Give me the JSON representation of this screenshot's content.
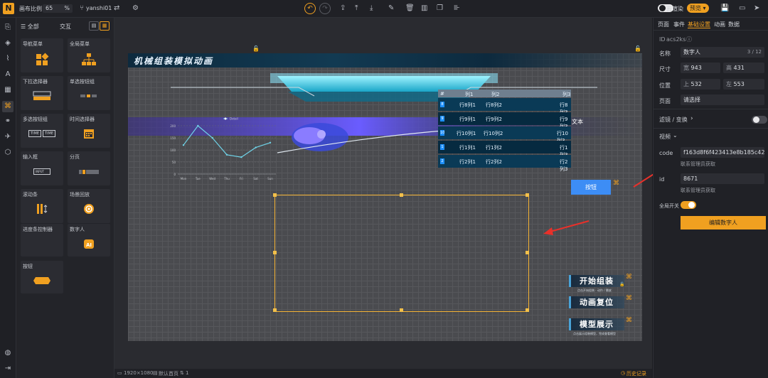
{
  "toolbar": {
    "logo_glyph": "N",
    "scale_label": "画布比例",
    "scale_value": "65",
    "scale_unit": "%",
    "user_name": "yanshi01",
    "cloud_render_label": "云渲染",
    "preview_label": "预览"
  },
  "left_panel": {
    "tab_all": "全部",
    "tab_interact": "交互",
    "components": [
      {
        "label": "导航菜单"
      },
      {
        "label": "全局菜单"
      },
      {
        "label": "下拉选择器"
      },
      {
        "label": "单选按钮组"
      },
      {
        "label": "多选按钮组"
      },
      {
        "label": "时间选择器"
      },
      {
        "label": "输入框"
      },
      {
        "label": "分页"
      },
      {
        "label": "滚动条"
      },
      {
        "label": "场景回放"
      },
      {
        "label": "进度条控制器"
      },
      {
        "label": "数字人"
      },
      {
        "label": "按钮"
      }
    ],
    "input_placeholder": "INPUT",
    "time_a": "TIME",
    "time_b": "TIME"
  },
  "stage": {
    "title": "机械组装模拟动画",
    "table": {
      "headers": [
        "#",
        "列1",
        "列2",
        "列3"
      ],
      "rows": [
        {
          "n": "8",
          "c1": "行8列1",
          "c2": "行8列2",
          "c3": "行8列3"
        },
        {
          "n": "9",
          "c1": "行9列1",
          "c2": "行9列2",
          "c3": "行9列3"
        },
        {
          "n": "10",
          "c1": "行10列1",
          "c2": "行10列2",
          "c3": "行10列3"
        },
        {
          "n": "1",
          "c1": "行1列1",
          "c2": "行1列2",
          "c3": "行1列3"
        },
        {
          "n": "2",
          "c1": "行2列1",
          "c2": "行2列2",
          "c3": "行2列3"
        }
      ]
    },
    "text_label": "文本",
    "button_label": "按钮",
    "action_buttons": [
      {
        "label": "开始组装",
        "sub": "点击开始组装 · 动作 / 播放"
      },
      {
        "label": "动画复位",
        "sub": ""
      },
      {
        "label": "模型展示",
        "sub": "点击展示组装模型，完成查看模型"
      }
    ]
  },
  "chart_data": {
    "type": "line",
    "categories": [
      "Mon",
      "Tue",
      "Wed",
      "Thu",
      "Fri",
      "Sat",
      "Sun"
    ],
    "series": [
      {
        "name": "Detail",
        "values": [
          120,
          200,
          150,
          80,
          70,
          110,
          130
        ]
      }
    ],
    "ylim": [
      0,
      200
    ],
    "yticks": [
      0,
      50,
      100,
      150,
      200
    ],
    "color": "#6fd3e8"
  },
  "status": {
    "resolution": "1920×1080",
    "page_label": "默认首页",
    "layer_count": "1",
    "history_label": "历史记录"
  },
  "right_panel": {
    "tabs": [
      "页面",
      "事件",
      "基础设置",
      "动画",
      "数据"
    ],
    "active_tab": "基础设置",
    "id_label": "ID",
    "id_value": "acs2ks",
    "name_label": "名称",
    "name_value": "数字人",
    "name_count": "3 / 12",
    "size_label": "尺寸",
    "width_prefix": "宽",
    "width_value": "943",
    "height_prefix": "高",
    "height_value": "431",
    "pos_label": "位置",
    "top_prefix": "上",
    "top_value": "532",
    "left_prefix": "左",
    "left_value": "553",
    "page_label": "页面",
    "page_value": "请选择",
    "filter_label": "滤镜 / 变换",
    "video_label": "视频",
    "code_label": "code",
    "code_value": "f163d8f6f423413e8b185c42",
    "code_hint": "联系管理员获取",
    "vid_label": "id",
    "vid_value": "8671",
    "vid_hint": "联系管理员获取",
    "global_switch_label": "全局开关",
    "edit_button": "编辑数字人"
  },
  "colors": {
    "accent": "#f0a020",
    "table_header": "#6f7f8f",
    "table_row_a": "#0a3a56",
    "table_row_b": "#062a40",
    "stage_button": "#3d8df5"
  }
}
